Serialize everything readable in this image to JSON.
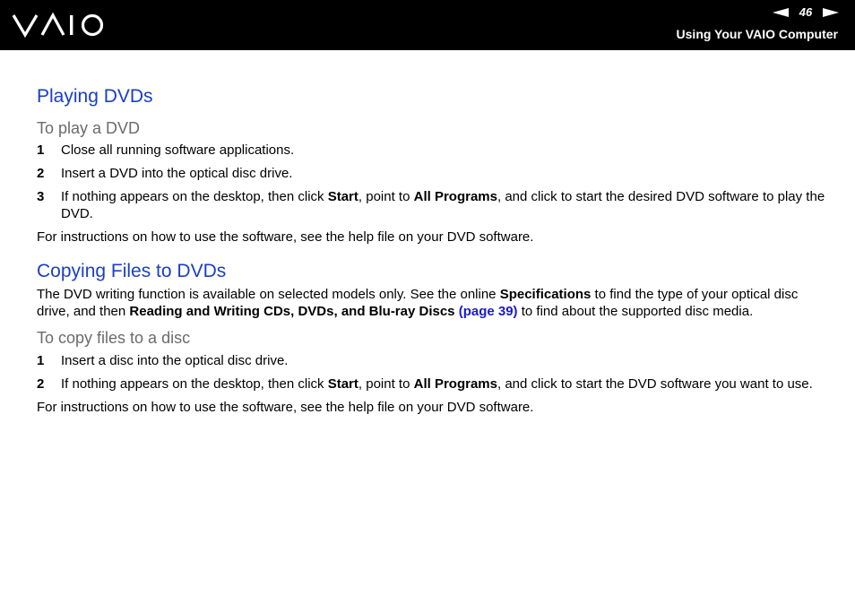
{
  "header": {
    "page_number": "46",
    "section": "Using Your VAIO Computer"
  },
  "s1": {
    "title": "Playing DVDs",
    "subtitle": "To play a DVD",
    "step1_num": "1",
    "step1": "Close all running software applications.",
    "step2_num": "2",
    "step2": "Insert a DVD into the optical disc drive.",
    "step3_num": "3",
    "step3_a": "If nothing appears on the desktop, then click ",
    "step3_b": "Start",
    "step3_c": ", point to ",
    "step3_d": "All Programs",
    "step3_e": ", and click to start the desired DVD software to play the DVD.",
    "note": "For instructions on how to use the software, see the help file on your DVD software."
  },
  "s2": {
    "title": "Copying Files to DVDs",
    "intro_a": "The DVD writing function is available on selected models only. See the online ",
    "intro_b": "Specifications",
    "intro_c": " to find the type of your optical disc drive, and then ",
    "intro_d": "Reading and Writing CDs, DVDs, and Blu-ray Discs",
    "intro_link": "(page 39)",
    "intro_e": " to find about the supported disc media.",
    "subtitle": "To copy files to a disc",
    "step1_num": "1",
    "step1": "Insert a disc into the optical disc drive.",
    "step2_num": "2",
    "step2_a": "If nothing appears on the desktop, then click ",
    "step2_b": "Start",
    "step2_c": ", point to ",
    "step2_d": "All Programs",
    "step2_e": ", and click to start the DVD software you want to use.",
    "note": "For instructions on how to use the software, see the help file on your DVD software."
  }
}
